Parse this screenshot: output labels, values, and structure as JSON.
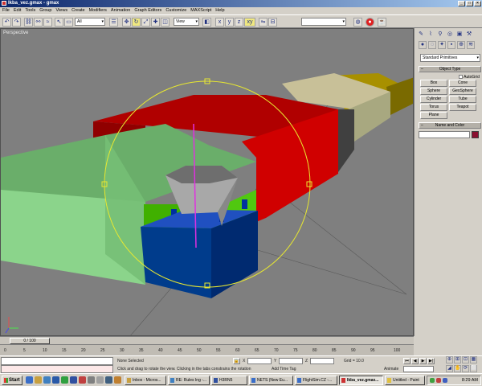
{
  "window": {
    "title": "lkba_vez.gmax - gmax"
  },
  "menu": [
    "File",
    "Edit",
    "Tools",
    "Group",
    "Views",
    "Create",
    "Modifiers",
    "Animation",
    "Graph Editors",
    "Customize",
    "MAXScript",
    "Help"
  ],
  "toolbar": {
    "selection_filter": "All",
    "ref_coord": "View"
  },
  "viewport": {
    "label": "Perspective"
  },
  "command_panel": {
    "category_dropdown": "Standard Primitives",
    "object_type_header": "Object Type",
    "autogrid_label": "AutoGrid",
    "buttons": [
      "Box",
      "Cone",
      "Sphere",
      "GeoSphere",
      "Cylinder",
      "Tube",
      "Torus",
      "Teapot",
      "Plane"
    ],
    "name_color_header": "Name and Color"
  },
  "timeslider": {
    "frame": "0 / 100",
    "ticks": [
      "0",
      "5",
      "10",
      "15",
      "20",
      "25",
      "30",
      "35",
      "40",
      "45",
      "50",
      "55",
      "60",
      "65",
      "70",
      "75",
      "80",
      "85",
      "90",
      "95",
      "100"
    ]
  },
  "status": {
    "selection": "None Selected",
    "prompt": "Click and drag to rotate the view.  Clicking in the tabs constrains the rotation",
    "add_time_tag": "Add Time Tag",
    "x_label": "X",
    "y_label": "Y",
    "z_label": "Z",
    "grid": "Grid = 10.0",
    "animate": "Animate"
  },
  "taskbar": {
    "start": "Start",
    "tasks": [
      "Inbox - Micros...",
      "RE: Rules Ing -...",
      "H3RN5",
      "NETS (New Eu...",
      "FlightSim.CZ -...",
      "lkba_vez.gmax...",
      "Untitled - Paint"
    ],
    "active_task_index": 5,
    "clock": "8:29 AM"
  },
  "colors": {
    "red_box": "#b00000",
    "green_wall": "#7ec87e",
    "blue_base": "#003c8c",
    "tower_green": "#40b000",
    "gizmo": "#e8e830",
    "object_color": "#8a1030"
  }
}
